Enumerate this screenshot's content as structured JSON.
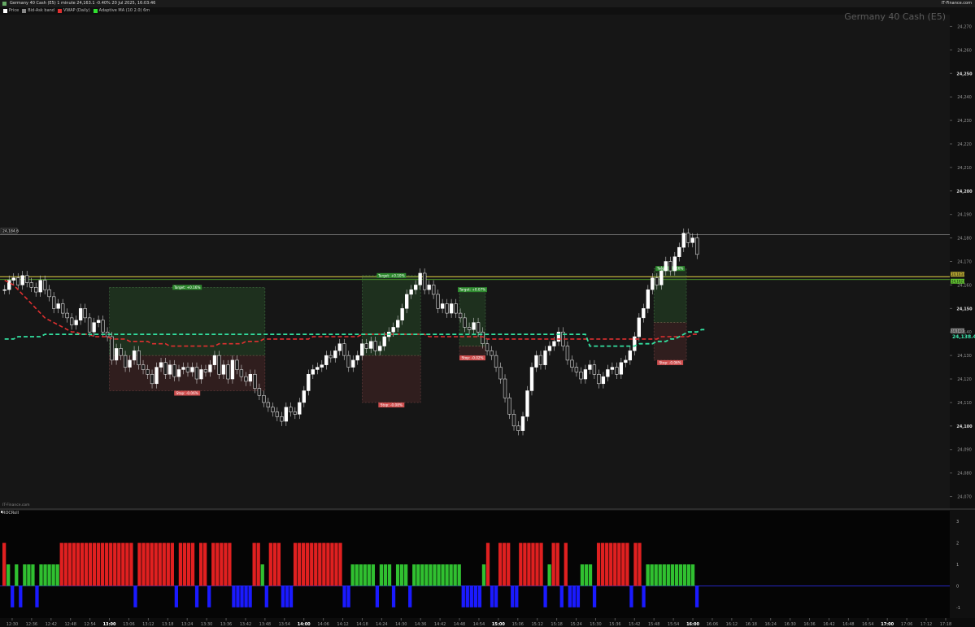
{
  "header": {
    "title": "Germany 40 Cash (E5) 1 minute 24,163.1 -0.40% 20 Jul 2025, 16:03:46",
    "brand": "IT-Finance.com"
  },
  "legend": [
    {
      "label": "Price",
      "color": "#ffffff"
    },
    {
      "label": "Bid-Ask band",
      "color": "#888888"
    },
    {
      "label": "VWAP (Daily)",
      "color": "#e03030"
    },
    {
      "label": "Adaptive MA (10 2.0) 6m",
      "color": "#30e030"
    }
  ],
  "watermark": "Germany 40 Cash (E5)",
  "footer_brand": "IT-Finance.com",
  "indicator_title": "ROCRoll",
  "colors": {
    "up": "#30c030",
    "down": "#e02020",
    "blue": "#1a1aff",
    "candle": "#ffffff",
    "vwap": "#e03030",
    "ama": "#33e0a0",
    "target": "#2a6a2a",
    "stop": "#6a2a2a"
  },
  "chart_data": [
    {
      "type": "candlestick",
      "title": "Germany 40 Cash (E5)",
      "ylim": [
        24065,
        24275
      ],
      "y_ticks": [
        "24,270",
        "24,260",
        "24,250",
        "24,240",
        "24,230",
        "24,220",
        "24,210",
        "24,200",
        "24,190",
        "24,180",
        "24,170",
        "24,160",
        "24,150",
        "24,140",
        "24,130",
        "24,120",
        "24,110",
        "24,100",
        "24,090",
        "24,080",
        "24,070"
      ],
      "x_ticks": [
        "12:30",
        "12:36",
        "12:42",
        "12:48",
        "12:54",
        "13:00",
        "13:06",
        "13:12",
        "13:18",
        "13:24",
        "13:30",
        "13:36",
        "13:42",
        "13:48",
        "13:54",
        "14:00",
        "14:06",
        "14:12",
        "14:18",
        "14:24",
        "14:30",
        "14:36",
        "14:42",
        "14:48",
        "14:54",
        "15:00",
        "15:06",
        "15:12",
        "15:18",
        "15:24",
        "15:30",
        "15:36",
        "15:42",
        "15:48",
        "15:54",
        "16:00",
        "16:06",
        "16:12",
        "16:18",
        "16:24",
        "16:30",
        "16:36",
        "16:42",
        "16:48",
        "16:54",
        "17:00",
        "17:06",
        "17:12",
        "17:18"
      ],
      "bold_ticks": [
        "13:00",
        "14:00",
        "15:00",
        "16:00",
        "17:00"
      ],
      "price_labels": {
        "last": "24,138.4",
        "level_high": "24,184.6",
        "level_a": "24,163.0",
        "level_b": "24,162.0",
        "level_c": "24,140.5"
      },
      "levels": {
        "high_line": 24181.5,
        "yellow_line": 24163.5,
        "green_line": 24162.3
      },
      "candles_close": [
        24158,
        24162,
        24163,
        24160,
        24164,
        24161,
        24159,
        24157,
        24162,
        24158,
        24155,
        24150,
        24152,
        24148,
        24146,
        24143,
        24145,
        24150,
        24146,
        24140,
        24144,
        24145,
        24140,
        24138,
        24128,
        24133,
        24130,
        24125,
        24128,
        24132,
        24126,
        24124,
        24122,
        24118,
        24125,
        24127,
        24122,
        24126,
        24121,
        24124,
        24125,
        24123,
        24125,
        24120,
        24124,
        24123,
        24126,
        24130,
        24122,
        24126,
        24120,
        24128,
        24124,
        24121,
        24119,
        24122,
        24116,
        24113,
        24110,
        24108,
        24106,
        24104,
        24102,
        24108,
        24106,
        24105,
        24110,
        24115,
        24122,
        24124,
        24125,
        24126,
        24130,
        24129,
        24132,
        24135,
        24130,
        24125,
        24128,
        24130,
        24135,
        24133,
        24136,
        24132,
        24134,
        24138,
        24140,
        24142,
        24145,
        24150,
        24156,
        24158,
        24160,
        24165,
        24158,
        24160,
        24156,
        24150,
        24152,
        24148,
        24152,
        24148,
        24146,
        24142,
        24141,
        24144,
        24140,
        24135,
        24132,
        24130,
        24125,
        24120,
        24112,
        24105,
        24100,
        24098,
        24104,
        24115,
        24125,
        24130,
        24126,
        24132,
        24134,
        24136,
        24140,
        24134,
        24128,
        24125,
        24123,
        24120,
        24124,
        24126,
        24122,
        24118,
        24121,
        24124,
        24125,
        24122,
        24127,
        24128,
        24132,
        24138,
        24146,
        24150,
        24158,
        24163,
        24160,
        24166,
        24170,
        24166,
        24172,
        24176,
        24182,
        24178,
        24180,
        24173
      ],
      "vwap": [
        24162,
        24161,
        24160,
        24158,
        24156,
        24154,
        24152,
        24150,
        24148,
        24146,
        24145,
        24144,
        24143,
        24142,
        24141,
        24140,
        24140,
        24139,
        24139,
        24139,
        24138,
        24138,
        24138,
        24138,
        24137,
        24137,
        24137,
        24137,
        24136,
        24136,
        24136,
        24136,
        24136,
        24135,
        24135,
        24135,
        24135,
        24134,
        24134,
        24134,
        24134,
        24134,
        24134,
        24134,
        24134,
        24134,
        24134,
        24134,
        24135,
        24135,
        24135,
        24135,
        24135,
        24135,
        24136,
        24136,
        24136,
        24136,
        24137,
        24137,
        24137,
        24137,
        24137,
        24137,
        24137,
        24137,
        24137,
        24137,
        24137,
        24138,
        24138,
        24138,
        24138,
        24138,
        24138,
        24138,
        24138,
        24138,
        24138,
        24138,
        24139,
        24139,
        24139,
        24139,
        24139,
        24139,
        24139,
        24139,
        24139,
        24139,
        24139,
        24139,
        24139,
        24139,
        24139,
        24138,
        24138,
        24138,
        24138,
        24138,
        24138,
        24138,
        24138,
        24138,
        24138,
        24138,
        24138,
        24138,
        24137,
        24137,
        24137,
        24137,
        24137,
        24137,
        24137,
        24137,
        24137,
        24137,
        24137,
        24137,
        24137,
        24137,
        24137,
        24137,
        24137,
        24137,
        24137,
        24137,
        24137,
        24137,
        24137,
        24137,
        24137,
        24137,
        24137,
        24137,
        24137,
        24137,
        24137,
        24137,
        24137,
        24137,
        24137,
        24137,
        24137,
        24137,
        24137,
        24138,
        24138,
        24138,
        24138,
        24138,
        24138,
        24138,
        24139,
        24139
      ],
      "ama": [
        24137,
        24137,
        24137,
        24138,
        24138,
        24138,
        24138,
        24138,
        24138,
        24139,
        24139,
        24139,
        24139,
        24139,
        24139,
        24139,
        24139,
        24139,
        24139,
        24139,
        24139,
        24139,
        24139,
        24139,
        24139,
        24139,
        24139,
        24139,
        24139,
        24139,
        24139,
        24139,
        24139,
        24139,
        24139,
        24139,
        24139,
        24139,
        24139,
        24139,
        24139,
        24139,
        24139,
        24139,
        24139,
        24139,
        24139,
        24139,
        24139,
        24139,
        24139,
        24139,
        24139,
        24139,
        24139,
        24139,
        24139,
        24139,
        24139,
        24139,
        24139,
        24139,
        24139,
        24139,
        24139,
        24139,
        24139,
        24139,
        24139,
        24139,
        24139,
        24139,
        24139,
        24139,
        24139,
        24139,
        24139,
        24139,
        24139,
        24139,
        24139,
        24139,
        24139,
        24139,
        24139,
        24139,
        24139,
        24139,
        24139,
        24139,
        24139,
        24139,
        24139,
        24139,
        24139,
        24139,
        24139,
        24139,
        24139,
        24139,
        24139,
        24139,
        24139,
        24139,
        24139,
        24139,
        24139,
        24139,
        24139,
        24139,
        24139,
        24139,
        24139,
        24139,
        24139,
        24139,
        24139,
        24139,
        24139,
        24139,
        24139,
        24139,
        24139,
        24139,
        24139,
        24139,
        24139,
        24139,
        24139,
        24139,
        24139,
        24134,
        24134,
        24134,
        24134,
        24134,
        24134,
        24134,
        24134,
        24134,
        24134,
        24134,
        24135,
        24135,
        24135,
        24135,
        24136,
        24136,
        24136,
        24137,
        24137,
        24138,
        24139,
        24140,
        24140,
        24140,
        24141,
        24141
      ],
      "trades": [
        {
          "target_label": "Target: +0.16%",
          "stop_label": "Stop: -0.06%",
          "start": "13:00",
          "end": "13:48",
          "entry": 24130,
          "target": 24159,
          "stop": 24115
        },
        {
          "target_label": "Target: +0.10%",
          "stop_label": "Stop: -0.08%",
          "start": "14:18",
          "end": "14:36",
          "entry": 24130,
          "target": 24164,
          "stop": 24110
        },
        {
          "target_label": "Target: +0.07%",
          "stop_label": "Stop: -0.02%",
          "start": "14:48",
          "end": "14:56",
          "entry": 24134,
          "target": 24158,
          "stop": 24130
        },
        {
          "target_label": "Target: +0.16%",
          "stop_label": "Stop: -0.06%",
          "start": "15:48",
          "end": "15:58",
          "entry": 24144,
          "target": 24167,
          "stop": 24128
        }
      ]
    },
    {
      "type": "bar",
      "title": "ROCRoll",
      "ylim": [
        -1.5,
        3.5
      ],
      "y_ticks": [
        "3",
        "2",
        "1",
        "0",
        "-1"
      ],
      "note": "values per minute bar: 2 = red, 1 = green, -1 = blue",
      "values": [
        2,
        1,
        -1,
        1,
        -1,
        1,
        1,
        1,
        -1,
        1,
        1,
        1,
        1,
        1,
        2,
        2,
        2,
        2,
        2,
        2,
        2,
        2,
        2,
        2,
        2,
        2,
        2,
        2,
        2,
        2,
        2,
        2,
        -1,
        2,
        2,
        2,
        2,
        2,
        2,
        2,
        2,
        2,
        -1,
        2,
        2,
        2,
        2,
        -1,
        2,
        2,
        -1,
        2,
        2,
        2,
        2,
        2,
        -1,
        -1,
        -1,
        -1,
        -1,
        2,
        2,
        1,
        -1,
        2,
        2,
        2,
        -1,
        -1,
        -1,
        2,
        2,
        2,
        2,
        2,
        2,
        2,
        2,
        2,
        2,
        2,
        2,
        -1,
        -1,
        1,
        1,
        1,
        1,
        1,
        1,
        -1,
        1,
        1,
        1,
        -1,
        1,
        1,
        1,
        -1,
        1,
        1,
        1,
        1,
        1,
        1,
        1,
        1,
        1,
        1,
        1,
        1,
        -1,
        -1,
        -1,
        -1,
        -1,
        1,
        2,
        -1,
        -1,
        2,
        2,
        2,
        -1,
        -1,
        2,
        2,
        2,
        2,
        2,
        2,
        -1,
        1,
        2,
        2,
        -1,
        2,
        -1,
        -1,
        -1,
        1,
        1,
        1,
        -1,
        2,
        2,
        2,
        2,
        2,
        2,
        2,
        2,
        -1,
        2,
        2,
        -1,
        1,
        1,
        1,
        1,
        1,
        1,
        1,
        1,
        1,
        1,
        1,
        1,
        -1
      ]
    }
  ]
}
